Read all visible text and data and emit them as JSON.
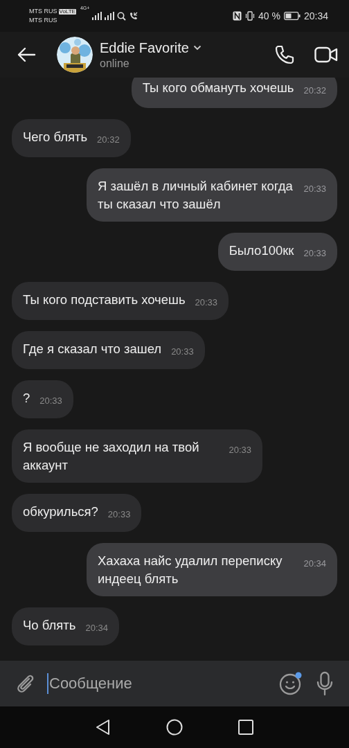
{
  "status_bar": {
    "carrier_1": "MTS RUS",
    "volte": "VoLTE",
    "carrier_2": "MTS RUS",
    "network": "4G+",
    "battery_percent": "40 %",
    "time": "20:34"
  },
  "header": {
    "name": "Eddie Favorite",
    "status": "online"
  },
  "messages": [
    {
      "text": "Ты кого обмануть хочешь",
      "time": "20:32",
      "outgoing": true
    },
    {
      "text": "Чего блять",
      "time": "20:32",
      "outgoing": false
    },
    {
      "text": "Я зашёл в личный кабинет когда ты сказал что зашёл",
      "time": "20:33",
      "outgoing": true
    },
    {
      "text": "Было100кк",
      "time": "20:33",
      "outgoing": true
    },
    {
      "text": "Ты кого подставить хочешь",
      "time": "20:33",
      "outgoing": false
    },
    {
      "text": "Где я сказал что зашел",
      "time": "20:33",
      "outgoing": false
    },
    {
      "text": "?",
      "time": "20:33",
      "outgoing": false
    },
    {
      "text": "Я вообще не заходил на твой аккаунт",
      "time": "20:33",
      "outgoing": false
    },
    {
      "text": "обкурилься?",
      "time": "20:33",
      "outgoing": false
    },
    {
      "text": "Хахаха найс удалил переписку индеец блять",
      "time": "20:34",
      "outgoing": true
    },
    {
      "text": "Чо блять",
      "time": "20:34",
      "outgoing": false
    }
  ],
  "composer": {
    "placeholder": "Сообщение",
    "emoji_badge": true
  }
}
